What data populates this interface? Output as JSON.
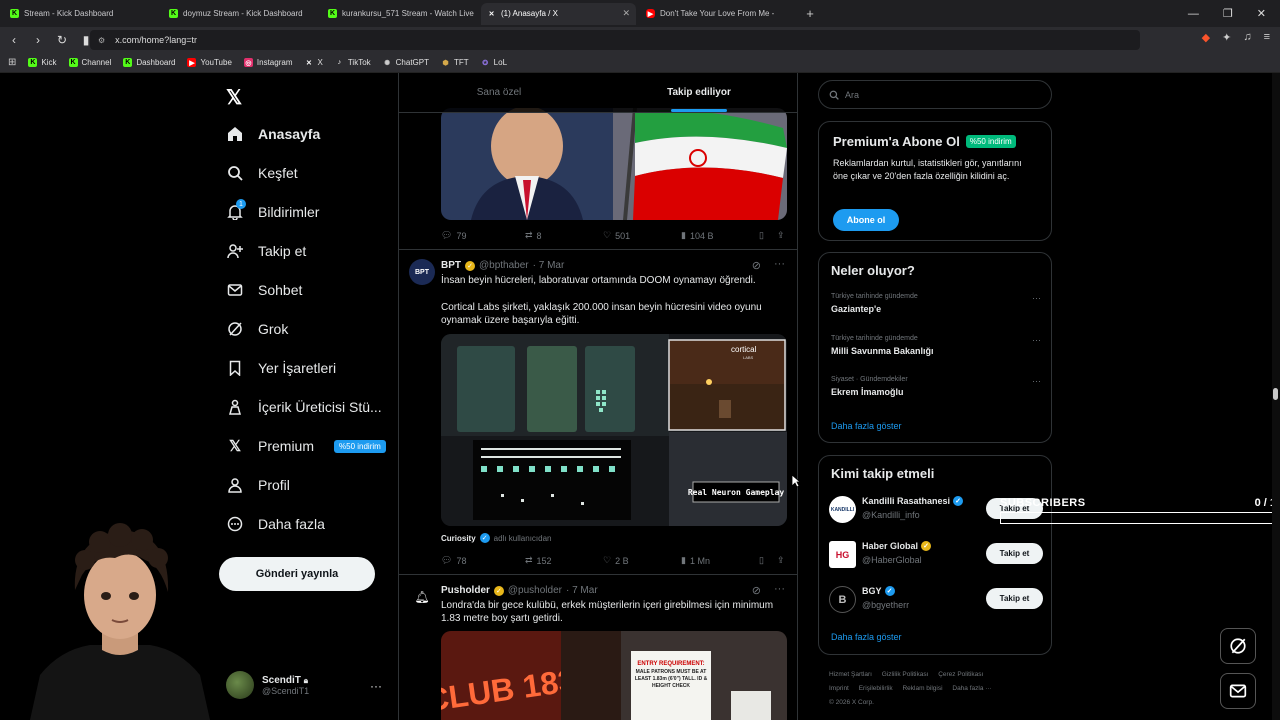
{
  "browser": {
    "tabs": [
      {
        "label": "Stream - Kick Dashboard",
        "icon": "kick-icon",
        "active": false
      },
      {
        "label": "doymuz Stream - Kick Dashboard",
        "icon": "kick-icon",
        "active": false
      },
      {
        "label": "kurankursu_571 Stream - Watch Live",
        "icon": "kick-icon",
        "active": false
      },
      {
        "label": "(1) Anasayfa / X",
        "icon": "x-icon",
        "active": true
      },
      {
        "label": "Don't Take Your Love From Me -",
        "icon": "youtube-icon",
        "active": false
      }
    ],
    "url": "x.com/home?lang=tr",
    "bookmarks": [
      {
        "label": "Kick",
        "icon": "kick-icon",
        "color": "#53fc18"
      },
      {
        "label": "Channel",
        "icon": "kick-icon",
        "color": "#53fc18"
      },
      {
        "label": "Dashboard",
        "icon": "kick-icon",
        "color": "#53fc18"
      },
      {
        "label": "YouTube",
        "icon": "youtube-icon",
        "color": "#ff0000"
      },
      {
        "label": "Instagram",
        "icon": "instagram-icon",
        "color": "#e1306c"
      },
      {
        "label": "X",
        "icon": "x-icon",
        "color": "#ffffff"
      },
      {
        "label": "TikTok",
        "icon": "tiktok-icon",
        "color": "#ffffff"
      },
      {
        "label": "ChatGPT",
        "icon": "chatgpt-icon",
        "color": "#cccccc"
      },
      {
        "label": "TFT",
        "icon": "tft-icon",
        "color": "#d4a84a"
      },
      {
        "label": "LoL",
        "icon": "lol-icon",
        "color": "#8a6fd8"
      }
    ]
  },
  "nav": {
    "items": [
      {
        "label": "Anasayfa",
        "icon": "home-icon"
      },
      {
        "label": "Keşfet",
        "icon": "search-icon"
      },
      {
        "label": "Bildirimler",
        "icon": "bell-icon",
        "badge": "1"
      },
      {
        "label": "Takip et",
        "icon": "add-user-icon"
      },
      {
        "label": "Sohbet",
        "icon": "mail-icon"
      },
      {
        "label": "Grok",
        "icon": "grok-icon"
      },
      {
        "label": "Yer İşaretleri",
        "icon": "bookmark-icon"
      },
      {
        "label": "İçerik Üreticisi Stü...",
        "icon": "creator-icon"
      },
      {
        "label": "Premium",
        "icon": "x-icon",
        "badge": "%50 indirim"
      },
      {
        "label": "Profil",
        "icon": "person-icon"
      },
      {
        "label": "Daha fazla",
        "icon": "more-icon"
      }
    ],
    "post_button": "Gönderi yayınla",
    "profile": {
      "name": "ScendiT",
      "handle": "@ScendiT1"
    }
  },
  "feed": {
    "tabs": [
      "Sana özel",
      "Takip ediliyor"
    ],
    "tweet1": {
      "replies": "79",
      "retweets": "8",
      "likes": "501",
      "views": "104 B"
    },
    "tweet2": {
      "name": "BPT",
      "handle": "@bpthaber",
      "date": "· 7 Mar",
      "text1": "İnsan beyin hücreleri, laboratuvar ortamında DOOM oynamayı öğrendi.",
      "text2": "Cortical Labs şirketi, yaklaşık 200.000 insan beyin hücresini video oyunu oynamak üzere başarıyla eğitti.",
      "media_text1": "cortical",
      "media_text2": "LABS",
      "media_text3": "Real Neuron Gameplay",
      "attrib_name": "Curiosity",
      "attrib_suffix": "adlı kullanıcıdan",
      "replies": "78",
      "retweets": "152",
      "likes": "2 B",
      "views": "1 Mn"
    },
    "tweet3": {
      "name": "Pusholder",
      "handle": "@pusholder",
      "date": "· 7 Mar",
      "text": "Londra'da bir gece kulübü, erkek müşterilerin içeri girebilmesi için minimum 1.83 metre boy şartı getirdi.",
      "media_sign": "CLUB 183",
      "media_notice_title": "ENTRY REQUIREMENT:",
      "media_notice_body": "MALE PATRONS MUST BE AT LEAST 1.83m (6'0\") TALL. ID & HEIGHT CHECK"
    }
  },
  "sidebar": {
    "search_placeholder": "Ara",
    "premium": {
      "title": "Premium'a Abone Ol",
      "badge": "%50 indirim",
      "text": "Reklamlardan kurtul, istatistikleri gör, yanıtlarını öne çıkar ve 20'den fazla özelliğin kilidini aç.",
      "button": "Abone ol"
    },
    "trends": {
      "title": "Neler oluyor?",
      "items": [
        {
          "context": "Türkiye tarihinde gündemde",
          "topic": "Gaziantep'e"
        },
        {
          "context": "Türkiye tarihinde gündemde",
          "topic": "Milli Savunma Bakanlığı"
        },
        {
          "context": "Siyaset · Gündemdekiler",
          "topic": "Ekrem İmamoğlu"
        }
      ],
      "show_more": "Daha fazla göster"
    },
    "who_to_follow": {
      "title": "Kimi takip etmeli",
      "items": [
        {
          "name": "Kandilli Rasathanesi",
          "handle": "@Kandilli_info",
          "avatar_text": "KANDILLI",
          "button": "Takip et"
        },
        {
          "name": "Haber Global",
          "handle": "@HaberGlobal",
          "avatar_text": "HG",
          "button": "Takip et"
        },
        {
          "name": "BGY",
          "handle": "@bgyetherr",
          "avatar_text": "B",
          "button": "Takip et"
        }
      ],
      "show_more": "Daha fazla göster"
    },
    "footer": [
      "Hizmet Şartları",
      "Gizlilik Politikası",
      "Çerez Politikası",
      "Imprint",
      "Erişilebilirlik",
      "Reklam bilgisi",
      "Daha fazla ···",
      "© 2026 X Corp."
    ]
  },
  "overlay": {
    "subs_label": "SUBSCRIBERS",
    "subs_count": "0 / 1",
    "subs_progress": 0
  }
}
